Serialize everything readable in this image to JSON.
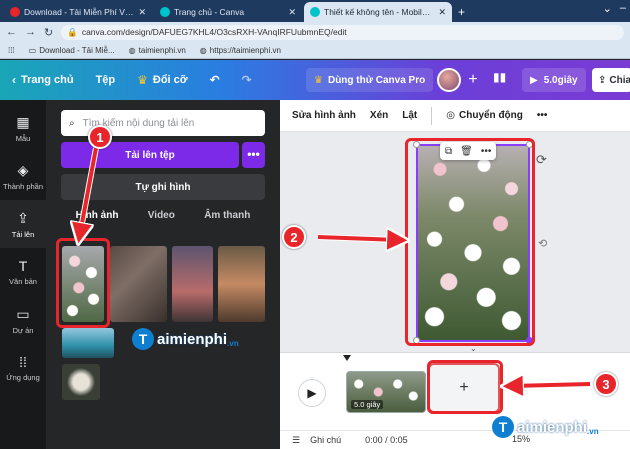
{
  "browser": {
    "tabs": [
      {
        "title": "Download - Tải Miễn Phí VN - Ph",
        "favicon_color": "#e8252b",
        "active": false
      },
      {
        "title": "Trang chủ - Canva",
        "favicon_color": "#00c4cc",
        "active": false
      },
      {
        "title": "Thiết kế không tên - Mobile Video",
        "favicon_color": "#00c4cc",
        "active": true
      }
    ],
    "url": "canva.com/design/DAFUEG7KHL4/O3csRXH-VAnqIRFUubmnEQ/edit",
    "bookmarks": [
      {
        "label": "Download - Tải Miễ..."
      },
      {
        "label": "taimienphi.vn"
      },
      {
        "label": "https://taimienphi.vn"
      }
    ]
  },
  "header": {
    "home": "Trang chủ",
    "file": "Tệp",
    "resize": "Đổi cỡ",
    "trial": "Dùng thử Canva Pro",
    "duration": "5.0giây",
    "share": "Chia"
  },
  "rail": [
    {
      "icon": "▦",
      "label": "Mẫu",
      "active": false
    },
    {
      "icon": "◈",
      "label": "Thành phần",
      "active": false
    },
    {
      "icon": "⇪",
      "label": "Tải lên",
      "active": true
    },
    {
      "icon": "T",
      "label": "Văn bản",
      "active": false
    },
    {
      "icon": "▭",
      "label": "Dự án",
      "active": false
    },
    {
      "icon": "⁞⁞",
      "label": "Ứng dụng",
      "active": false
    }
  ],
  "panel": {
    "search_placeholder": "Tìm kiếm nội dung tải lên",
    "upload_label": "Tải lên tệp",
    "more_label": "•••",
    "record_label": "Tự ghi hình",
    "subtabs": [
      "Hình ảnh",
      "Video",
      "Âm thanh"
    ]
  },
  "editor": {
    "toolbar": [
      "Sửa hình ảnh",
      "Xén",
      "Lật"
    ],
    "animate": "Chuyển động",
    "more": "•••",
    "clip_label": "5.0 giây",
    "add_page": "+",
    "notes": "Ghi chú",
    "time": "0:00 / 0:05",
    "zoom": "15%"
  },
  "annotations": [
    "1",
    "2",
    "3"
  ],
  "watermark": {
    "brand_a": "T",
    "brand_b": "aimienphi",
    "suffix": ".vn"
  }
}
